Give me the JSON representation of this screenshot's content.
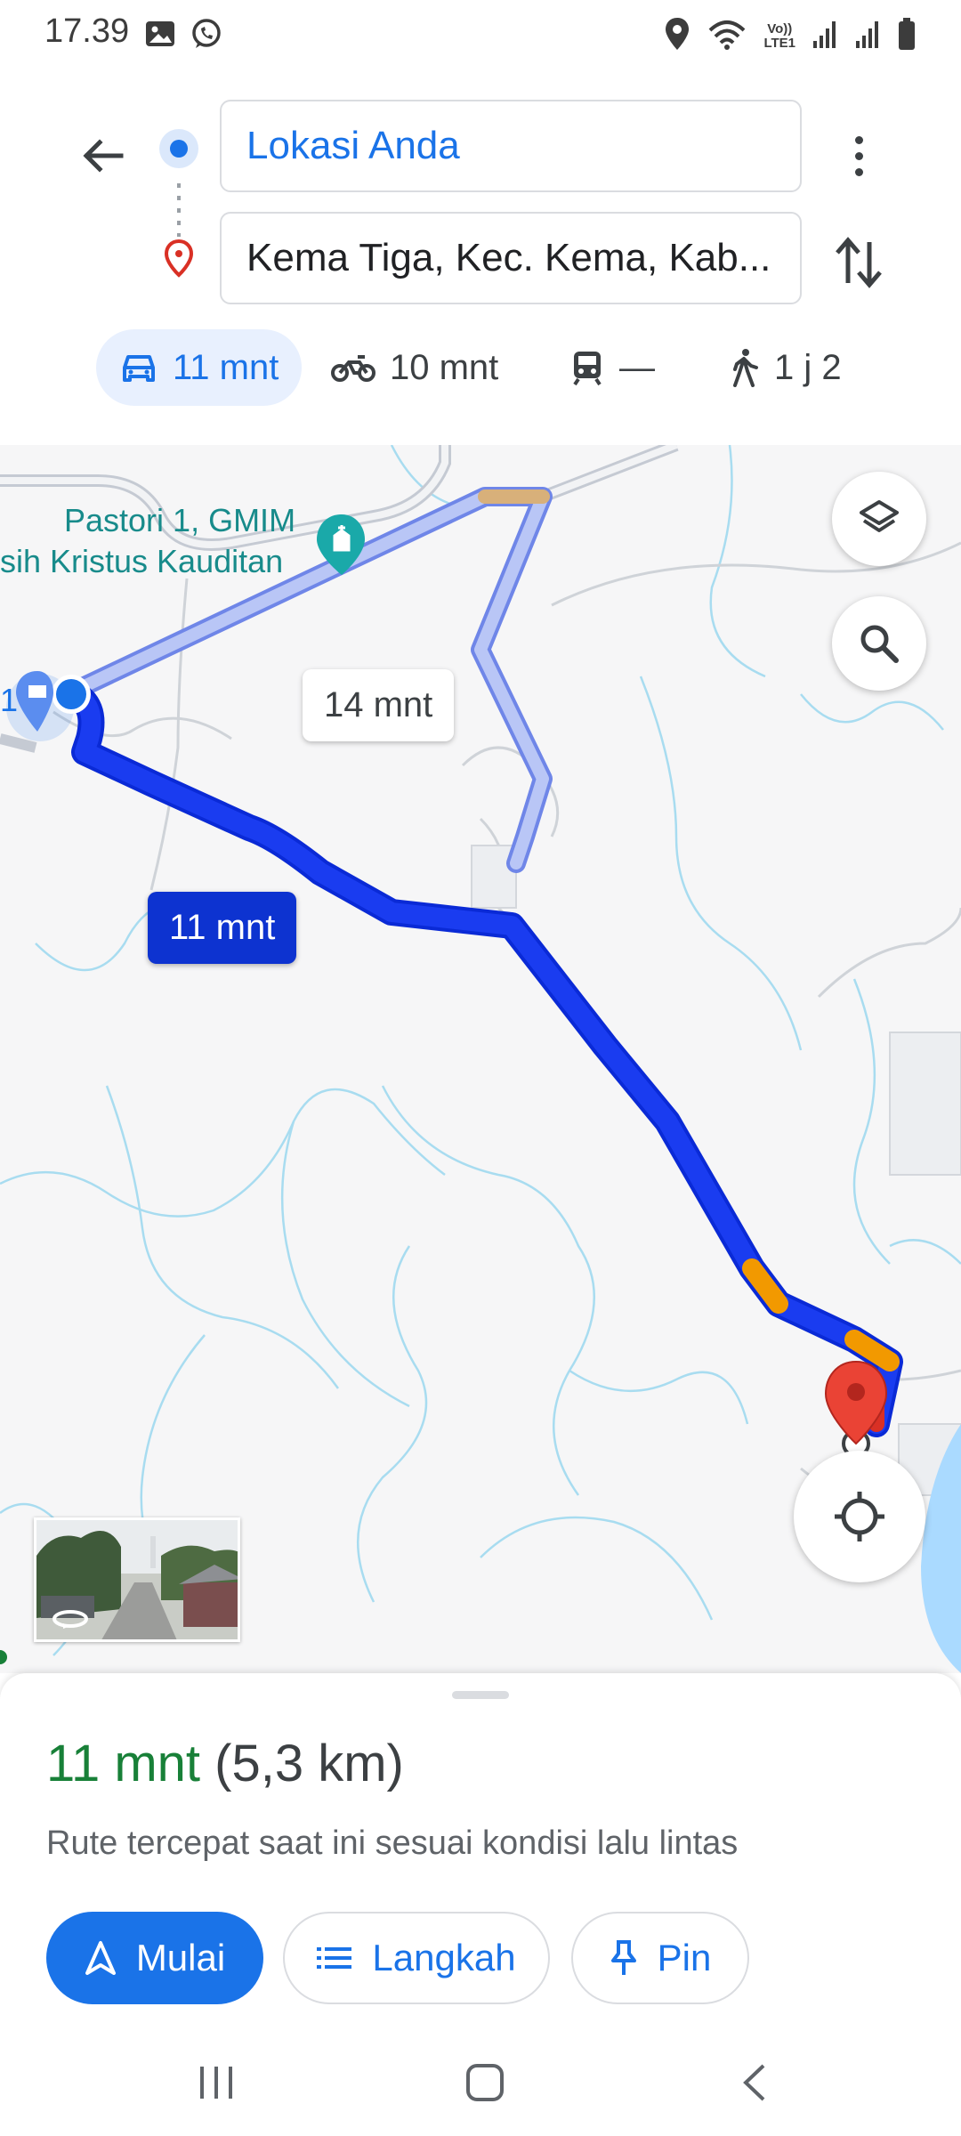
{
  "status_bar": {
    "time": "17.39",
    "left_icons": [
      "image-icon",
      "whatsapp-icon"
    ],
    "right_icons": [
      "location-icon",
      "wifi-icon",
      "volte-icon",
      "signal-icon",
      "signal-icon",
      "battery-icon"
    ],
    "network_label_top": "Vo))",
    "network_label_bottom": "LTE1"
  },
  "directions": {
    "origin": "Lokasi Anda",
    "destination": "Kema Tiga, Kec. Kema, Kab..."
  },
  "travel_modes": [
    {
      "icon": "car-icon",
      "label": "11 mnt",
      "active": true
    },
    {
      "icon": "motorcycle-icon",
      "label": "10 mnt",
      "active": false
    },
    {
      "icon": "train-icon",
      "label": "—",
      "active": false
    },
    {
      "icon": "walk-icon",
      "label": "1 j 2",
      "active": false
    }
  ],
  "map": {
    "place_label_line1": "Pastori 1, GMIM",
    "place_label_line2": "sih Kristus Kauditan",
    "edge_label": "1",
    "alt_route_label": "14 mnt",
    "main_route_label": "11 mnt",
    "colors": {
      "route_main": "#1a3cf0",
      "route_alt": "#aebcf5",
      "traffic_slow": "#f29900",
      "water": "#aadaff",
      "river": "#a8dcf0",
      "pin": "#ea4335"
    }
  },
  "summary": {
    "time": "11 mnt",
    "distance": "(5,3 km)",
    "description": "Rute tercepat saat ini sesuai kondisi lalu lintas"
  },
  "actions": {
    "start_label": "Mulai",
    "steps_label": "Langkah",
    "pin_label": "Pin"
  },
  "system_nav": [
    "recents-icon",
    "home-icon",
    "back-icon"
  ]
}
